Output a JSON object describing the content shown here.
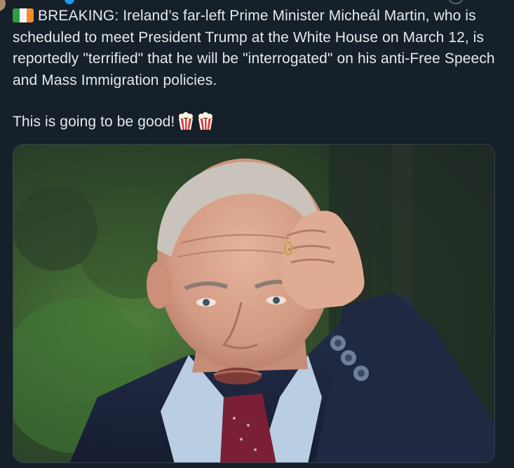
{
  "tweet": {
    "flag_icon": "ireland-flag-icon",
    "paragraph_1": "BREAKING: Ireland’s far-left Prime Minister Micheál Martin, who is scheduled to meet President Trump at the White House on March 12, is reportedly \"terrified\" that he will be \"interrogated\" on his anti-Free Speech and Mass Immigration policies.",
    "paragraph_2": "This is going to be good!",
    "emoji_icons": [
      "popcorn-icon",
      "popcorn-icon"
    ]
  },
  "media": {
    "type": "photo",
    "subject": "man-scratching-head",
    "colors": {
      "background_green": "#3c6a30",
      "suit_navy": "#1e2a45",
      "skin": "#d9a58e",
      "tie": "#7a1f35",
      "shirt": "#b9cde3"
    }
  },
  "theme": {
    "background": "#15202b",
    "text": "#e7e9ea",
    "border": "#38444d"
  }
}
